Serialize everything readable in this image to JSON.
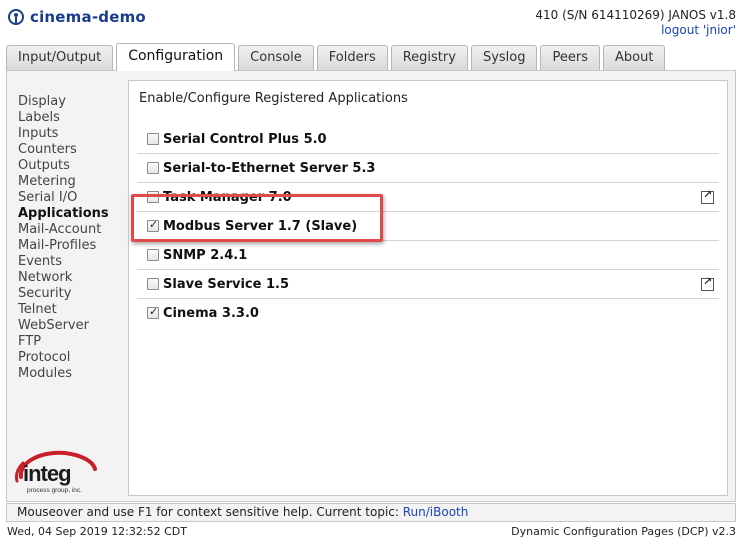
{
  "header": {
    "app_name": "cinema-demo",
    "device_info": "410 (S/N 614110269) JANOS v1.8",
    "logout": "logout 'jnior'"
  },
  "tabs": [
    {
      "label": "Input/Output",
      "active": false
    },
    {
      "label": "Configuration",
      "active": true
    },
    {
      "label": "Console",
      "active": false
    },
    {
      "label": "Folders",
      "active": false
    },
    {
      "label": "Registry",
      "active": false
    },
    {
      "label": "Syslog",
      "active": false
    },
    {
      "label": "Peers",
      "active": false
    },
    {
      "label": "About",
      "active": false
    }
  ],
  "sidebar": {
    "items": [
      {
        "label": "Display"
      },
      {
        "label": "Labels"
      },
      {
        "label": "Inputs"
      },
      {
        "label": "Counters"
      },
      {
        "label": "Outputs"
      },
      {
        "label": "Metering"
      },
      {
        "label": "Serial I/O"
      },
      {
        "label": "Applications",
        "active": true
      },
      {
        "label": "Mail-Account"
      },
      {
        "label": "Mail-Profiles"
      },
      {
        "label": "Events"
      },
      {
        "label": "Network"
      },
      {
        "label": "Security"
      },
      {
        "label": "Telnet"
      },
      {
        "label": "WebServer"
      },
      {
        "label": "FTP"
      },
      {
        "label": "Protocol"
      },
      {
        "label": "Modules"
      }
    ],
    "logo_text": "integ",
    "logo_subtext": "process group, inc."
  },
  "main": {
    "title": "Enable/Configure Registered Applications",
    "applications": [
      {
        "label": "Serial Control Plus 5.0",
        "checked": false,
        "has_link": false
      },
      {
        "label": "Serial-to-Ethernet Server 5.3",
        "checked": false,
        "has_link": false
      },
      {
        "label": "Task Manager 7.0",
        "checked": false,
        "has_link": true
      },
      {
        "label": "Modbus Server 1.7 (Slave)",
        "checked": true,
        "has_link": false
      },
      {
        "label": "SNMP 2.4.1",
        "checked": false,
        "has_link": false
      },
      {
        "label": "Slave Service 1.5",
        "checked": false,
        "has_link": true
      },
      {
        "label": "Cinema 3.3.0",
        "checked": true,
        "has_link": false
      }
    ]
  },
  "helpbar": {
    "text": "Mouseover and use F1 for context sensitive help. Current topic: ",
    "topic": "Run/iBooth"
  },
  "footer": {
    "datetime": "Wed, 04 Sep 2019 12:32:52 CDT",
    "version": "Dynamic Configuration Pages (DCP) v2.3"
  },
  "colors": {
    "brand": "#1a3c8c",
    "link": "#1a44b8",
    "highlight": "#e04a4a",
    "logo_red": "#c8202a"
  }
}
